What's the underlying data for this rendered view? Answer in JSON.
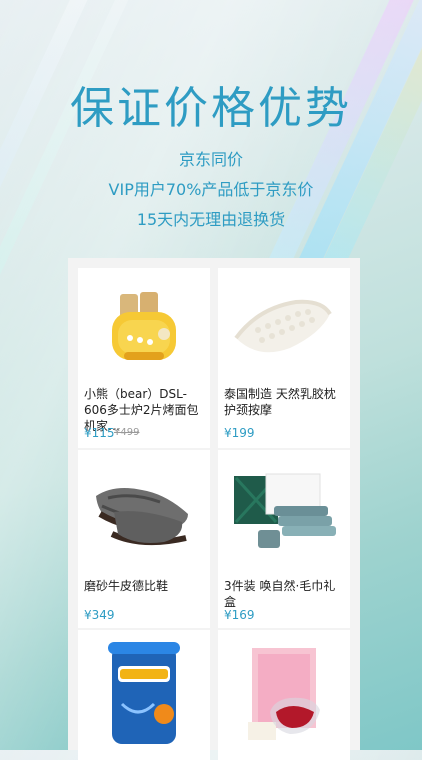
{
  "hero": {
    "title": "保证价格优势",
    "line1": "京东同价",
    "line2": "VIP用户70%产品低于京东价",
    "line3": "15天内无理由退换货"
  },
  "products": [
    {
      "title": "小熊（bear）DSL-606多士炉2片烤面包机家…",
      "price": "¥115",
      "old_price": "¥499"
    },
    {
      "title": "泰国制造 天然乳胶枕护颈按摩",
      "price": "¥199",
      "old_price": ""
    },
    {
      "title": "磨砂牛皮德比鞋",
      "price": "¥349",
      "old_price": ""
    },
    {
      "title": "3件装 唤自然·毛巾礼盒",
      "price": "¥169",
      "old_price": ""
    },
    {
      "title": "",
      "price": "",
      "old_price": ""
    },
    {
      "title": "",
      "price": "",
      "old_price": ""
    }
  ],
  "images": {
    "toaster": "toaster-image",
    "pillow": "latex-pillow-image",
    "shoe": "derby-shoe-image",
    "towels": "towel-gift-box-image",
    "milk": "nutrilon-formula-can-image",
    "tea": "tea-gift-box-image"
  },
  "colors": {
    "accent": "#2e9cc3",
    "text": "#222222",
    "muted": "#999999"
  }
}
